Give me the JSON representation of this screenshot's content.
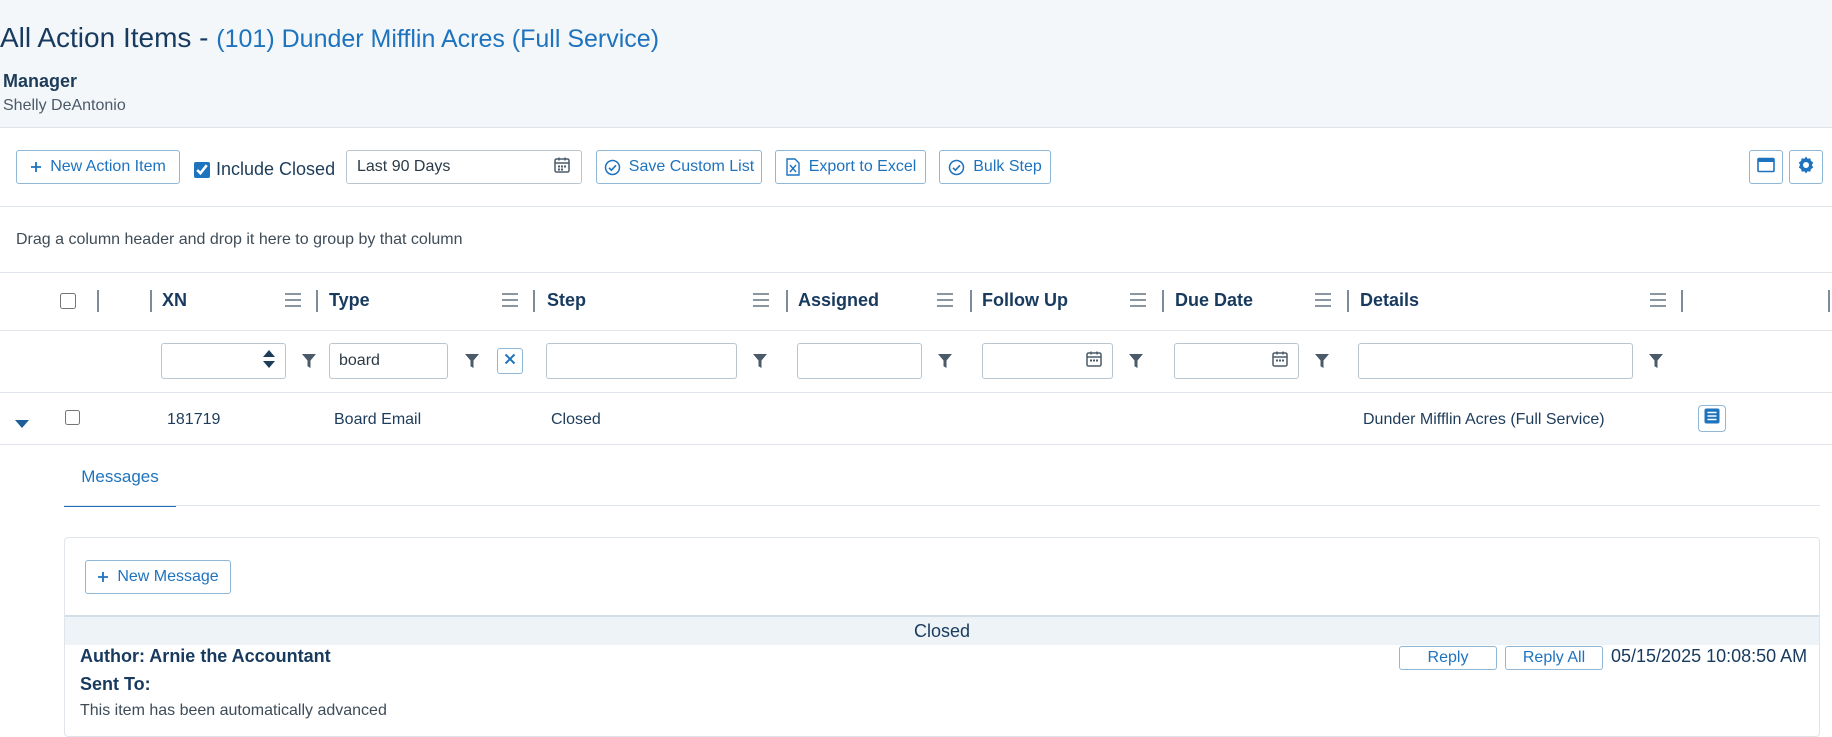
{
  "header": {
    "title_prefix": "All Action Items - ",
    "title_association": "(101) Dunder Mifflin Acres (Full Service)",
    "manager_label": "Manager",
    "manager_name": "Shelly DeAntonio"
  },
  "toolbar": {
    "new_action_item": "New Action Item",
    "include_closed_label": "Include Closed",
    "include_closed_checked": true,
    "date_range_value": "Last 90 Days",
    "save_custom_list": "Save Custom List",
    "export_excel": "Export to Excel",
    "bulk_step": "Bulk Step"
  },
  "grid": {
    "group_hint": "Drag a column header and drop it here to group by that column",
    "columns": {
      "xn": "XN",
      "type": "Type",
      "step": "Step",
      "assigned": "Assigned",
      "follow_up": "Follow Up",
      "due_date": "Due Date",
      "details": "Details"
    },
    "filters": {
      "type_value": "board"
    },
    "rows": [
      {
        "xn": "181719",
        "type": "Board Email",
        "step": "Closed",
        "assigned": "",
        "follow_up": "",
        "due_date": "",
        "details": "Dunder Mifflin Acres (Full Service)"
      }
    ]
  },
  "detail": {
    "tab_messages": "Messages",
    "new_message": "New Message",
    "message": {
      "status": "Closed",
      "author": "Author: Arnie the Accountant",
      "sent_to": "Sent To:",
      "body": "This item has been automatically advanced",
      "reply": "Reply",
      "reply_all": "Reply All",
      "date": "05/15/2025 10:08:50 AM"
    }
  },
  "colors": {
    "accent": "#1e73be",
    "heading": "#173a5e",
    "border": "#dfe5ea"
  }
}
